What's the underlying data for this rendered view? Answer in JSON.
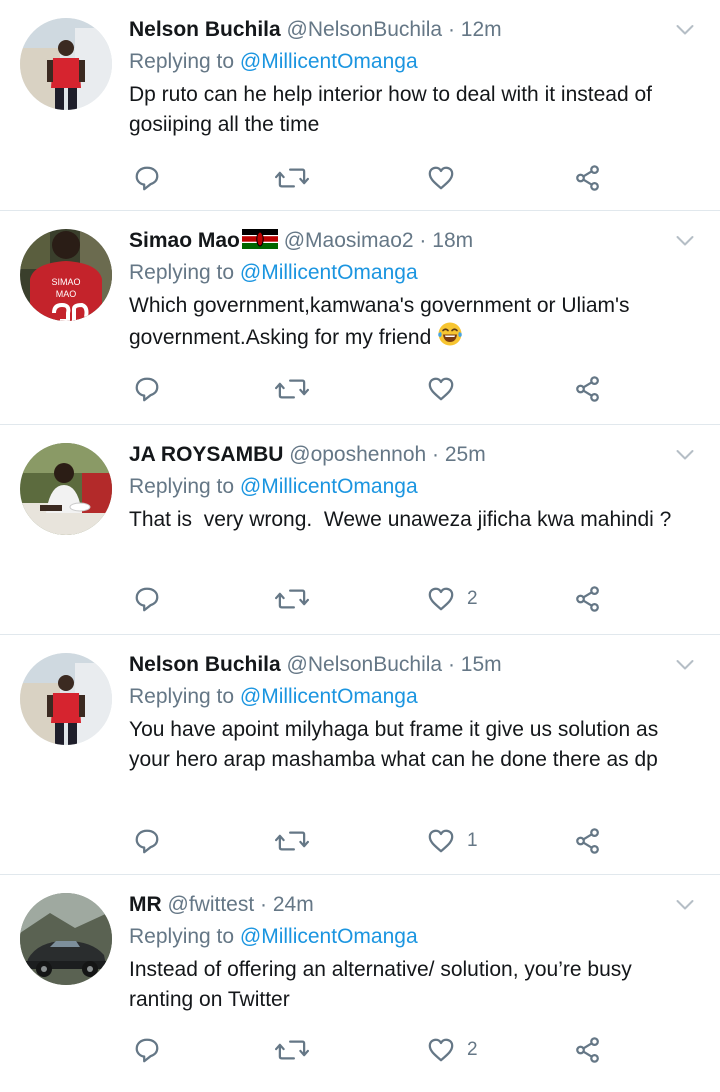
{
  "tweets": [
    {
      "name": "Nelson Buchila",
      "handle": "@NelsonBuchila",
      "time": "12m",
      "replying_prefix": "Replying to",
      "replying_to": "@MillicentOmanga",
      "text": "Dp ruto can he help interior how to deal with it instead of gosiiping all the time",
      "likes": "",
      "avatar_colors": [
        "#c8d6e5",
        "#d6242f"
      ]
    },
    {
      "name": "Simao Mao",
      "handle": "@Maosimao2",
      "time": "18m",
      "replying_prefix": "Replying to",
      "replying_to": "@MillicentOmanga",
      "text": "Which government,kamwana's government or Uliam's government.Asking for my friend",
      "likes": "",
      "avatar_jersey_text": [
        "SIMAO",
        "MAO"
      ]
    },
    {
      "name": "JA ROYSAMBU",
      "handle": "@oposhennoh",
      "time": "25m",
      "replying_prefix": "Replying to",
      "replying_to": "@MillicentOmanga",
      "text": "That is  very wrong.  Wewe unaweza jificha kwa mahindi ?",
      "likes": "2"
    },
    {
      "name": "Nelson Buchila",
      "handle": "@NelsonBuchila",
      "time": "15m",
      "replying_prefix": "Replying to",
      "replying_to": "@MillicentOmanga",
      "text": "You have apoint milyhaga but frame it give us solution as your hero arap mashamba what can he done there as dp",
      "likes": "1"
    },
    {
      "name": "MR",
      "handle": "@fwittest",
      "time": "24m",
      "replying_prefix": "Replying to",
      "replying_to": "@MillicentOmanga",
      "text": "Instead of offering an alternative/ solution, you’re busy ranting on Twitter",
      "likes": "2"
    }
  ],
  "separator": "·",
  "icons": {
    "reply": "reply-icon",
    "retweet": "retweet-icon",
    "like": "like-icon",
    "share": "share-icon",
    "menu": "chevron-down-icon"
  },
  "colors": {
    "name": "#14171a",
    "secondary": "#657786",
    "mention": "#1b95e0",
    "divider": "#e1e8ed"
  }
}
